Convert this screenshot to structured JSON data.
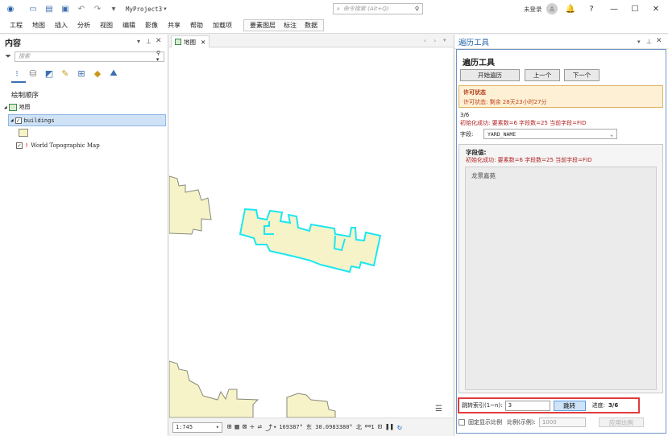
{
  "titlebar": {
    "project": "MyProject3",
    "search_placeholder": "命令搜索 (Alt+Q)",
    "user": "未登录"
  },
  "ribbon": {
    "tabs": [
      "工程",
      "地图",
      "插入",
      "分析",
      "视图",
      "编辑",
      "影像",
      "共享",
      "帮助",
      "加载项"
    ],
    "context_tabs": [
      "要素图层",
      "标注",
      "数据"
    ]
  },
  "contents": {
    "title": "内容",
    "search_placeholder": "搜索",
    "section": "绘制顺序",
    "map_name": "地图",
    "layer_name": "buildings",
    "basemap_name": "World Topographic Map"
  },
  "map": {
    "tab_label": "地图",
    "scale": "1:745",
    "coords": "169387° 东 30.0983380° 北",
    "selected_count": "1"
  },
  "tool": {
    "pane_title": "遍历工具",
    "heading": "遍历工具",
    "btn_start": "开始遍历",
    "btn_prev": "上一个",
    "btn_next": "下一个",
    "license_title": "许可状态",
    "license_text": "许可状态: 剩余 28天23小时27分",
    "progress_text": "3/6",
    "init_msg": "初始化成功: 要素数=6 字段数=25 当前字段=FID",
    "field_label": "字段:",
    "field_value": "YARD_NAME",
    "value_label": "字段值:",
    "value_init_msg": "初始化成功: 要素数=6 字段数=25 当前字段=FID",
    "value_text": "龙景嘉苑",
    "jump_label": "跳转索引(1~n):",
    "jump_value": "3",
    "jump_btn": "跳转",
    "progress_label": "进度:",
    "progress_value": "3/6",
    "fixed_scale_label": "固定显示比例",
    "scale_label": "比例(示例):",
    "scale_value": "1000",
    "apply_scale_btn": "应用比例"
  },
  "colors": {
    "accent": "#1f5fa8",
    "building_fill": "#f6f3c8",
    "building_stroke": "#8a8a7a",
    "selection": "#1ee6f0",
    "error_text": "#b22222",
    "highlight_border": "#e23b3b"
  }
}
